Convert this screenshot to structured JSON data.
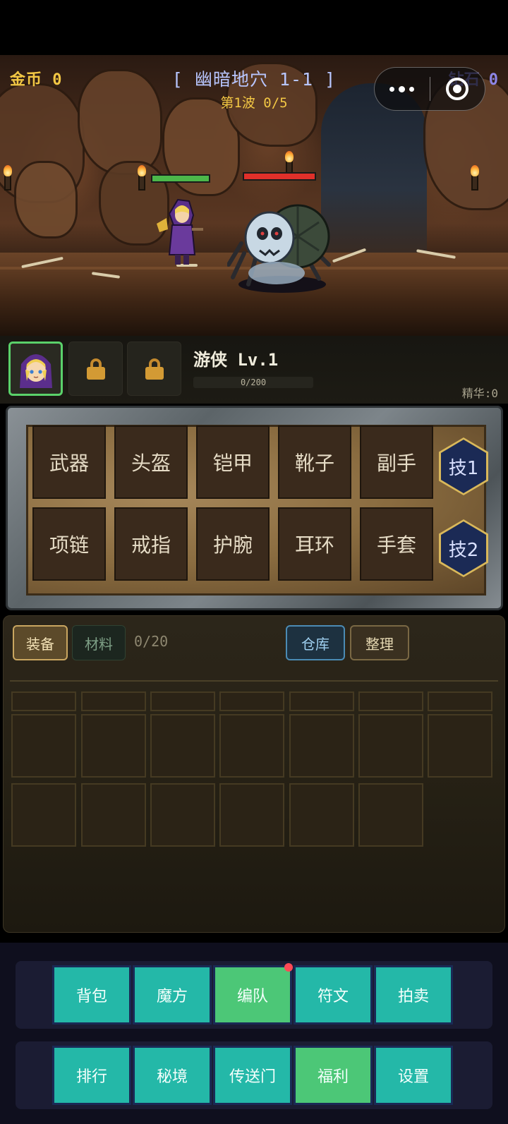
{
  "hud": {
    "gold": "金币 0",
    "stage": "[ 幽暗地穴 1-1 ]",
    "wave": "第1波 0/5",
    "diamond": "钻石 0",
    "hero_hp": 1.0,
    "enemy_hp": 1.0
  },
  "party": {
    "hero_name": "游侠 Lv.1",
    "xp": "0/200",
    "xp_progress": 0,
    "essence": "精华:0",
    "slots": [
      "hero-portrait",
      "lock-icon",
      "lock-icon"
    ]
  },
  "equipment": {
    "row1": [
      "武器",
      "头盔",
      "铠甲",
      "靴子",
      "副手"
    ],
    "row2": [
      "项链",
      "戒指",
      "护腕",
      "耳环",
      "手套"
    ],
    "skills": [
      "技1",
      "技2"
    ]
  },
  "inventory": {
    "tab_equip": "装备",
    "tab_material": "材料",
    "count": "0/20",
    "warehouse": "仓库",
    "sort": "整理"
  },
  "nav": {
    "row1": [
      "背包",
      "魔方",
      "编队",
      "符文",
      "拍卖"
    ],
    "row2": [
      "排行",
      "秘境",
      "传送门",
      "福利",
      "设置"
    ]
  },
  "colors": {
    "nav_teal": "#24b8a8",
    "nav_green": "#4cc777",
    "gold_text": "#f2c744",
    "hp_green": "#4cb84a",
    "hp_red": "#e0302a"
  }
}
